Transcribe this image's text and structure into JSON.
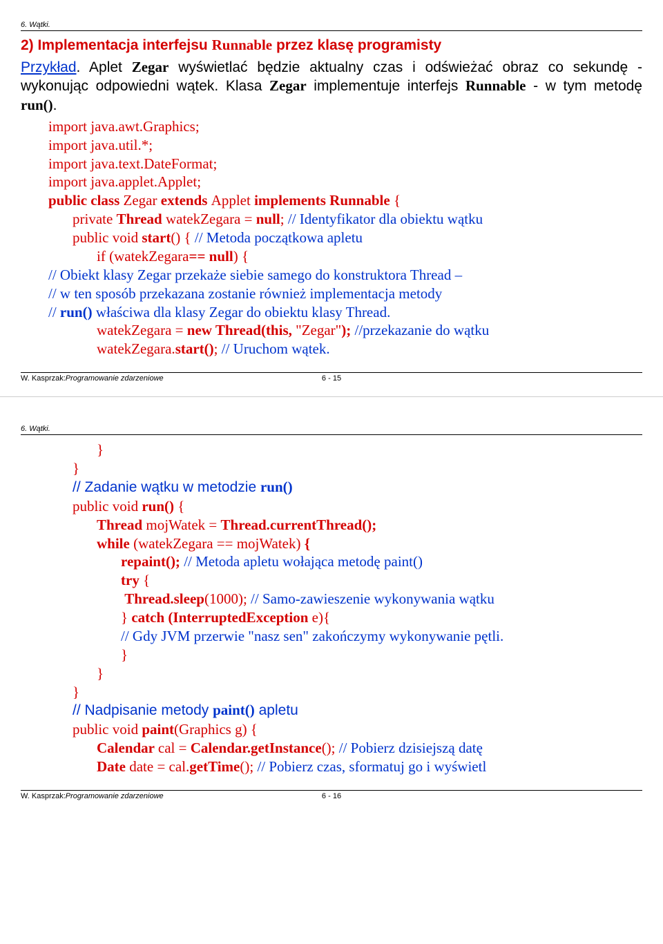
{
  "slide1": {
    "header": "6. Wątki.",
    "title_pre": "2) Implementacja interfejsu ",
    "title_code": "Runnable",
    "title_post": " przez klasę programisty",
    "intro": {
      "przyklad": "Przykład",
      "sent1_a": ". Aplet ",
      "sent1_zegar1": "Zegar",
      "sent1_b": " wyświetlać będzie aktualny czas i odświeżać obraz co sekundę - wykonując odpowiedni wątek. Klasa ",
      "sent1_zegar2": "Zegar",
      "sent1_c": " implementuje interfejs ",
      "sent1_runnable": "Runnable",
      "sent1_d": " - w tym metodę ",
      "sent1_run": "run()",
      "sent1_e": "."
    },
    "code": {
      "l1": "import java.awt.Graphics;",
      "l2": "import java.util.*;",
      "l3": "import java.text.DateFormat;",
      "l4": "import java.applet.Applet;",
      "l5_a": "public class ",
      "l5_b": "Zegar ",
      "l5_c": "extends ",
      "l5_d": "Applet ",
      "l5_e": "implements Runnable ",
      "l5_f": "{",
      "l6_a": "private ",
      "l6_b": "Thread ",
      "l6_c": "watekZegara = ",
      "l6_d": "null",
      "l6_e": "; ",
      "l6_comment": "// Identyfikator dla obiektu wątku",
      "l7_a": "public void ",
      "l7_b": "start",
      "l7_c": "() {  ",
      "l7_comment": "// Metoda początkowa apletu",
      "l8_a": "if ",
      "l8_b": "(watekZegara",
      "l8_c": "== null",
      "l8_d": ") {",
      "l9": "// Obiekt klasy Zegar przekaże siebie samego do konstruktora Thread –",
      "l10": "// w ten sposób przekazana zostanie również implementacja metody",
      "l11_a": "// ",
      "l11_b": "run()",
      "l11_c": " właściwa dla klasy Zegar do obiektu klasy Thread.",
      "l12_a": "watekZegara = ",
      "l12_b": "new Thread(this, ",
      "l12_c": "\"Zegar\"",
      "l12_d": "); ",
      "l12_comment": "//przekazanie do wątku",
      "l13_a": "watekZegara.",
      "l13_b": "start()",
      "l13_c": "; ",
      "l13_comment": "// Uruchom wątek."
    },
    "footer_author": "W. Kasprzak: ",
    "footer_course": "Programowanie zdarzeniowe",
    "footer_page": "6 - 15"
  },
  "slide2": {
    "header": "6. Wątki.",
    "code": {
      "l1": "}",
      "l2": "}",
      "l3_a": "// Zadanie wątku w metodzie ",
      "l3_b": "run()",
      "l4_a": "public void ",
      "l4_b": "run() ",
      "l4_c": "{",
      "l5_a": "Thread ",
      "l5_b": "mojWatek = ",
      "l5_c": "Thread.currentThread();",
      "l6_a": "while ",
      "l6_b": "(watekZegara == mojWatek) ",
      "l6_c": "{",
      "l7_a": "repaint(); ",
      "l7_comment": "// Metoda apletu wołająca metodę paint()",
      "l8_a": "try ",
      "l8_b": "{",
      "l9_a": "Thread.sleep",
      "l9_b": "(1000); ",
      "l9_comment": "// Samo-zawieszenie wykonywania wątku",
      "l10_a": "} ",
      "l10_b": "catch (InterruptedException ",
      "l10_c": "e){",
      "l11": "// Gdy JVM przerwie \"nasz sen\" zakończymy wykonywanie pętli.",
      "l12": "}",
      "l13": "}",
      "l14": "}",
      "l15_a": "// Nadpisanie metody ",
      "l15_b": "paint()",
      "l15_c": " apletu",
      "l16_a": "public void ",
      "l16_b": "paint",
      "l16_c": "(Graphics g) {",
      "l17_a": "Calendar ",
      "l17_b": "cal = ",
      "l17_c": "Calendar.getInstance",
      "l17_d": "(); ",
      "l17_comment": "// Pobierz dzisiejszą datę",
      "l18_a": "Date ",
      "l18_b": "date = cal.",
      "l18_c": "getTime",
      "l18_d": "(); ",
      "l18_comment": "// Pobierz czas, sformatuj go i wyświetl"
    },
    "footer_author": "W. Kasprzak: ",
    "footer_course": "Programowanie zdarzeniowe",
    "footer_page": "6 - 16"
  }
}
